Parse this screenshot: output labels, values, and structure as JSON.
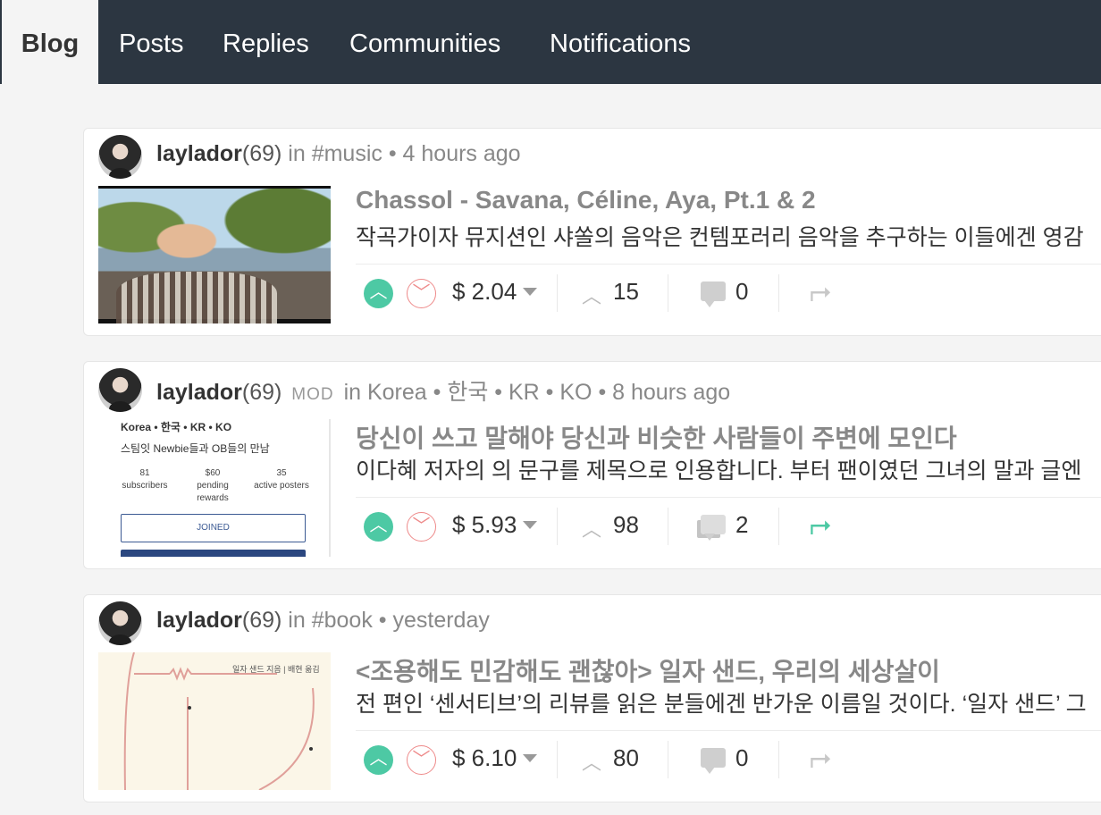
{
  "nav": {
    "tabs": [
      {
        "label": "Blog",
        "active": true
      },
      {
        "label": "Posts"
      },
      {
        "label": "Replies"
      },
      {
        "label": "Communities"
      },
      {
        "label": "Notifications"
      }
    ]
  },
  "colors": {
    "nav_bg": "#2c3641",
    "upvote": "#4dc9a4",
    "downvote": "#ee8a8a",
    "reblogged": "#4dc9a4"
  },
  "posts": [
    {
      "author": "laylador",
      "reputation": "(69)",
      "badge": "",
      "community": "in #music",
      "time": "• 4 hours ago",
      "title": "Chassol - Savana, Céline, Aya, Pt.1 & 2",
      "excerpt": "작곡가이자 뮤지션인 샤쏠의 음악은 컨템포러리 음악을 추구하는 이들에겐 영감",
      "payout": "$ 2.04",
      "votes": "15",
      "comments": "0",
      "reblogged": false
    },
    {
      "author": "laylador",
      "reputation": "(69)",
      "badge": "MOD",
      "community": "in Korea • 한국 • KR • KO",
      "time": "• 8 hours ago",
      "title": "당신이 쓰고 말해야 당신과 비슷한 사람들이 주변에 모인다",
      "excerpt": "이다혜 저자의 의 문구를 제목으로 인용합니다. 부터 팬이였던 그녀의 말과 글엔",
      "payout": "$ 5.93",
      "votes": "98",
      "comments": "2",
      "reblogged": true,
      "thumbnail": {
        "heading": "Korea • 한국 • KR • KO",
        "subtitle": "스팀잇 Newbie들과 OB들의 만남",
        "stats": [
          {
            "value": "81",
            "label": "subscribers"
          },
          {
            "value": "$60",
            "label": "pending rewards"
          },
          {
            "value": "35",
            "label": "active posters"
          }
        ],
        "button": "JOINED"
      }
    },
    {
      "author": "laylador",
      "reputation": "(69)",
      "badge": "",
      "community": "in #book",
      "time": "• yesterday",
      "title": "<조용해도 민감해도 괜찮아> 일자 샌드, 우리의 세상살이",
      "excerpt": "전 편인 ‘센서티브’의 리뷰를 읽은 분들에겐 반가운 이름일 것이다. ‘일자 샌드’ 그",
      "payout": "$ 6.10",
      "votes": "80",
      "comments": "0",
      "reblogged": false,
      "thumbnail": {
        "caption": "일자 샌드 지음 | 배현 옮김"
      }
    }
  ],
  "icons": {
    "upvote": "chevron-up-circle",
    "downvote": "chevron-down-circle",
    "payout_dropdown": "caret-down",
    "votes": "chevron-up",
    "comments": "speech-bubble",
    "reblog": "reblog-arrow"
  }
}
